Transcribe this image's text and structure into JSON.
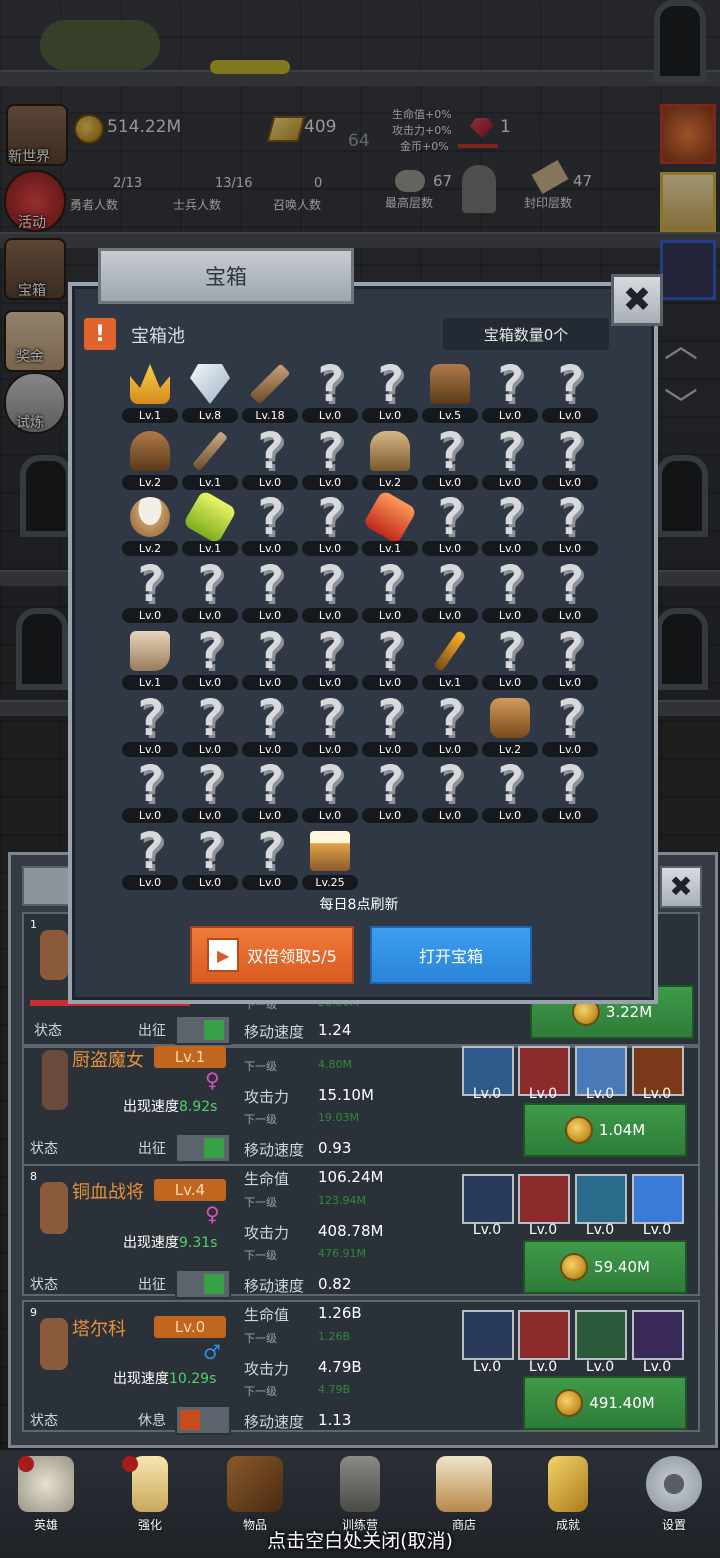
{
  "hud": {
    "gold": "514.22M",
    "bars": "409",
    "bars_sub": "64",
    "bonus_hp": "生命值+0%",
    "bonus_atk": "攻击力+0%",
    "bonus_gold": "金币+0%",
    "gems": "1",
    "heroes_val": "2/13",
    "heroes_label": "勇者人数",
    "soldiers_val": "13/16",
    "soldiers_label": "士兵人数",
    "summon_val": "0",
    "summon_label": "召唤人数",
    "max_floor_val": "67",
    "max_floor_label": "最高层数",
    "seal_floor_val": "47",
    "seal_floor_label": "封印层数"
  },
  "side_menu": [
    "新世界",
    "活动",
    "宝箱",
    "奖金",
    "试炼"
  ],
  "modal": {
    "title": "宝箱",
    "pool_title": "宝箱池",
    "count": "宝箱数量0个",
    "refresh_note": "每日8点刷新",
    "double_btn": "双倍领取5/5",
    "open_btn": "打开宝箱",
    "items": [
      {
        "icon": "crown",
        "lv": "Lv.1"
      },
      {
        "icon": "diamond",
        "lv": "Lv.8"
      },
      {
        "icon": "sword",
        "lv": "Lv.18"
      },
      {
        "icon": "unknown",
        "lv": "Lv.0"
      },
      {
        "icon": "unknown",
        "lv": "Lv.0"
      },
      {
        "icon": "chestplate",
        "lv": "Lv.5"
      },
      {
        "icon": "unknown",
        "lv": "Lv.0"
      },
      {
        "icon": "unknown",
        "lv": "Lv.0"
      },
      {
        "icon": "helmet",
        "lv": "Lv.2"
      },
      {
        "icon": "dagger",
        "lv": "Lv.1"
      },
      {
        "icon": "unknown",
        "lv": "Lv.0"
      },
      {
        "icon": "unknown",
        "lv": "Lv.0"
      },
      {
        "icon": "knight-helm",
        "lv": "Lv.2"
      },
      {
        "icon": "unknown",
        "lv": "Lv.0"
      },
      {
        "icon": "unknown",
        "lv": "Lv.0"
      },
      {
        "icon": "unknown",
        "lv": "Lv.0"
      },
      {
        "icon": "bowl",
        "lv": "Lv.2"
      },
      {
        "icon": "green-potion",
        "lv": "Lv.1"
      },
      {
        "icon": "unknown",
        "lv": "Lv.0"
      },
      {
        "icon": "unknown",
        "lv": "Lv.0"
      },
      {
        "icon": "red-potion",
        "lv": "Lv.1"
      },
      {
        "icon": "unknown",
        "lv": "Lv.0"
      },
      {
        "icon": "unknown",
        "lv": "Lv.0"
      },
      {
        "icon": "unknown",
        "lv": "Lv.0"
      },
      {
        "icon": "unknown",
        "lv": "Lv.0"
      },
      {
        "icon": "unknown",
        "lv": "Lv.0"
      },
      {
        "icon": "unknown",
        "lv": "Lv.0"
      },
      {
        "icon": "unknown",
        "lv": "Lv.0"
      },
      {
        "icon": "unknown",
        "lv": "Lv.0"
      },
      {
        "icon": "unknown",
        "lv": "Lv.0"
      },
      {
        "icon": "unknown",
        "lv": "Lv.0"
      },
      {
        "icon": "unknown",
        "lv": "Lv.0"
      },
      {
        "icon": "boot",
        "lv": "Lv.1"
      },
      {
        "icon": "unknown",
        "lv": "Lv.0"
      },
      {
        "icon": "unknown",
        "lv": "Lv.0"
      },
      {
        "icon": "unknown",
        "lv": "Lv.0"
      },
      {
        "icon": "unknown",
        "lv": "Lv.0"
      },
      {
        "icon": "torch",
        "lv": "Lv.1"
      },
      {
        "icon": "unknown",
        "lv": "Lv.0"
      },
      {
        "icon": "unknown",
        "lv": "Lv.0"
      },
      {
        "icon": "unknown",
        "lv": "Lv.0"
      },
      {
        "icon": "unknown",
        "lv": "Lv.0"
      },
      {
        "icon": "unknown",
        "lv": "Lv.0"
      },
      {
        "icon": "unknown",
        "lv": "Lv.0"
      },
      {
        "icon": "unknown",
        "lv": "Lv.0"
      },
      {
        "icon": "unknown",
        "lv": "Lv.0"
      },
      {
        "icon": "backpack",
        "lv": "Lv.2"
      },
      {
        "icon": "unknown",
        "lv": "Lv.0"
      },
      {
        "icon": "unknown",
        "lv": "Lv.0"
      },
      {
        "icon": "unknown",
        "lv": "Lv.0"
      },
      {
        "icon": "unknown",
        "lv": "Lv.0"
      },
      {
        "icon": "unknown",
        "lv": "Lv.0"
      },
      {
        "icon": "unknown",
        "lv": "Lv.0"
      },
      {
        "icon": "unknown",
        "lv": "Lv.0"
      },
      {
        "icon": "unknown",
        "lv": "Lv.0"
      },
      {
        "icon": "unknown",
        "lv": "Lv.0"
      },
      {
        "icon": "unknown",
        "lv": "Lv.0"
      },
      {
        "icon": "unknown",
        "lv": "Lv.0"
      },
      {
        "icon": "unknown",
        "lv": "Lv.0"
      },
      {
        "icon": "beer-mug",
        "lv": "Lv.25"
      }
    ]
  },
  "heroes": [
    {
      "status_label": "状态",
      "mode": "出征",
      "speed_label": "移动速度",
      "speed": "1.24",
      "upgrade": "3.22M",
      "next_label": "下一级",
      "next_val": "20.00M"
    },
    {
      "name": "厨盗魔女",
      "lv": "Lv.1",
      "gender": "♀",
      "spawn_label": "出现速度",
      "spawn": "8.92s",
      "hp_next": "4.80M",
      "atk_label": "攻击力",
      "atk": "15.10M",
      "atk_next": "19.03M",
      "next_label": "下一级",
      "status_label": "状态",
      "mode": "出征",
      "speed_label": "移动速度",
      "speed": "0.93",
      "upgrade": "1.04M",
      "skills": [
        "Lv.0",
        "Lv.0",
        "Lv.0",
        "Lv.0"
      ]
    },
    {
      "index": "8",
      "name": "铜血战将",
      "lv": "Lv.4",
      "gender": "♀",
      "spawn_label": "出现速度",
      "spawn": "9.31s",
      "hp_label": "生命值",
      "hp": "106.24M",
      "hp_next": "123.94M",
      "atk_label": "攻击力",
      "atk": "408.78M",
      "atk_next": "476.91M",
      "next_label": "下一级",
      "status_label": "状态",
      "mode": "出征",
      "speed_label": "移动速度",
      "speed": "0.82",
      "upgrade": "59.40M",
      "skills": [
        "Lv.0",
        "Lv.0",
        "Lv.0",
        "Lv.0"
      ]
    },
    {
      "index": "9",
      "name": "塔尔科",
      "lv": "Lv.0",
      "gender": "♂",
      "spawn_label": "出现速度",
      "spawn": "10.29s",
      "hp_label": "生命值",
      "hp": "1.26B",
      "hp_next": "1.26B",
      "atk_label": "攻击力",
      "atk": "4.79B",
      "atk_next": "4.79B",
      "next_label": "下一级",
      "status_label": "状态",
      "mode": "休息",
      "speed_label": "移动速度",
      "speed": "1.13",
      "upgrade": "491.40M",
      "skills": [
        "Lv.0",
        "Lv.0",
        "Lv.0",
        "Lv.0"
      ]
    }
  ],
  "card1_index": "1",
  "nav": [
    "英雄",
    "强化",
    "物品",
    "训练营",
    "商店",
    "成就",
    "设置"
  ],
  "hint": "点击空白处关闭(取消)",
  "colors": {
    "accent_orange": "#e0632b",
    "accent_blue": "#2b84d7",
    "accent_green": "#3aa048"
  }
}
